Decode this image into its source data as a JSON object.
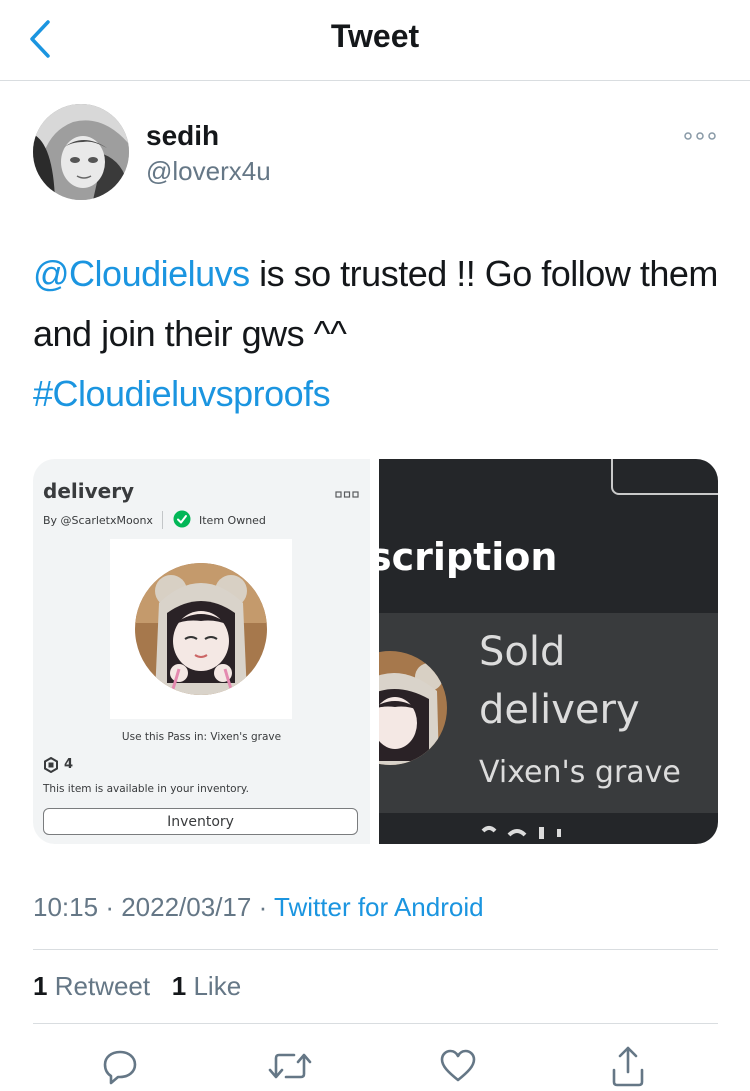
{
  "navbar": {
    "title": "Tweet",
    "back_icon": "chevron-left-icon"
  },
  "author": {
    "display_name": "sedih",
    "handle": "@loverx4u"
  },
  "tweet": {
    "mention": "@Cloudieluvs",
    "text": " is so trusted !! Go follow them and join their gws ^^",
    "hashtag": "#Cloudieluvsproofs"
  },
  "media": {
    "left": {
      "title": "delivery",
      "by": "By @ScarletxMoonx",
      "owned": "Item Owned",
      "use_pass": "Use this Pass in: Vixen's grave",
      "robux": "4",
      "available": "This item is available in your inventory.",
      "inventory_button": "Inventory"
    },
    "right": {
      "description_fragment": "scription",
      "sold": "Sold",
      "item": "delivery",
      "place": "Vixen's grave"
    }
  },
  "meta": {
    "time": "10:15",
    "date": "2022/03/17",
    "sep": "·",
    "source": "Twitter for Android"
  },
  "stats": {
    "retweets_count": "1",
    "retweets_label": "Retweet",
    "likes_count": "1",
    "likes_label": "Like"
  },
  "colors": {
    "link": "#1b95e0",
    "secondary_text": "#657786",
    "divider": "#d9dde0"
  }
}
